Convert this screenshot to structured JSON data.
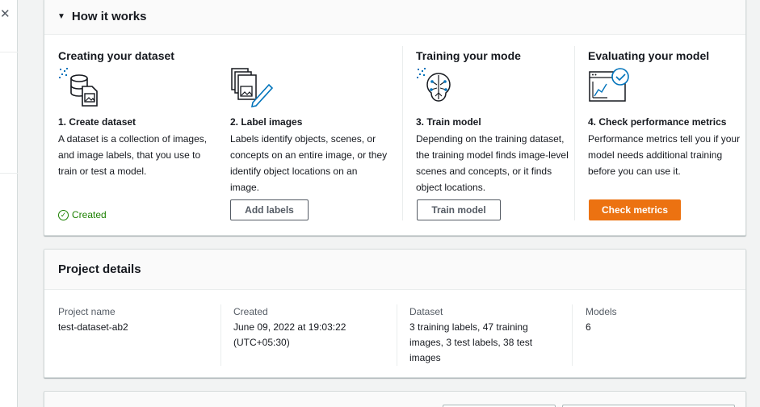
{
  "nav": {
    "close_icon": "close-icon"
  },
  "how_it_works": {
    "title": "How it works",
    "sections": {
      "create_dataset": "Creating your dataset",
      "train": "Training your mode",
      "evaluate": "Evaluating your model"
    },
    "steps": [
      {
        "title": "1. Create dataset",
        "description": "A dataset is a collection of images, and image labels, that you use to train or test a model.",
        "icon": "dataset-icon",
        "status": "Created"
      },
      {
        "title": "2. Label images",
        "description": "Labels identify objects, scenes, or concepts on an entire image, or they identify object locations on an image.",
        "icon": "label-images-icon",
        "button": "Add labels"
      },
      {
        "title": "3. Train model",
        "description": "Depending on the training dataset, the training model finds image-level scenes and concepts, or it finds object locations.",
        "icon": "brain-icon",
        "button": "Train model"
      },
      {
        "title": "4. Check performance metrics",
        "description": "Performance metrics tell you if your model needs additional training before you can use it.",
        "icon": "metrics-icon",
        "button": "Check metrics"
      }
    ]
  },
  "project_details": {
    "title": "Project details",
    "fields": [
      {
        "label": "Project name",
        "value": "test-dataset-ab2"
      },
      {
        "label": "Created",
        "value": "June 09, 2022 at 19:03:22 (UTC+05:30)"
      },
      {
        "label": "Dataset",
        "value": "3 training labels, 47 training images, 3 test labels, 38 test images"
      },
      {
        "label": "Models",
        "value": "6"
      }
    ]
  },
  "colors": {
    "primary": "#ec7211",
    "success": "#1d8102",
    "icon_blue": "#0073bb",
    "text": "#16191f",
    "muted": "#545b64"
  }
}
